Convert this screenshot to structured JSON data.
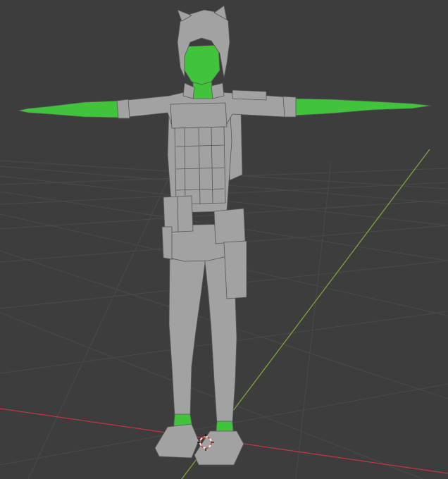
{
  "viewport": {
    "background": "#3d3d3d",
    "grid_line_color": "#4a4a4a",
    "x_axis_color": "#c0393e",
    "y_axis_color": "#7aa53a"
  },
  "model": {
    "pose": "T-pose",
    "body_color": "#a2a2a2",
    "selected_color": "#41c33c",
    "outline_color": "#555555"
  },
  "origin_cursor": {
    "icon": "3d-cursor-icon",
    "ring_color_a": "#d94a3a",
    "ring_color_b": "#f2f2f2"
  }
}
